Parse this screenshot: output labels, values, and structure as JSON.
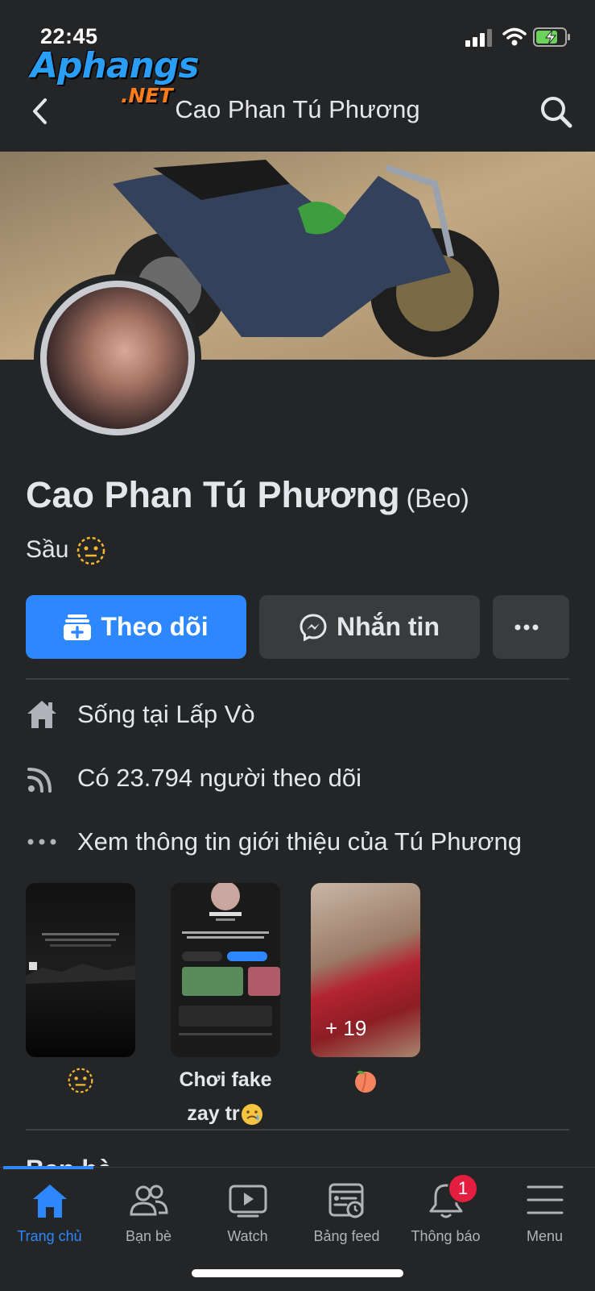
{
  "status_bar": {
    "time": "22:45"
  },
  "watermark": {
    "brand": "Aphangs",
    "domain": ".NET"
  },
  "header": {
    "title": "Cao Phan Tú Phương"
  },
  "profile": {
    "name": "Cao Phan Tú Phương",
    "nickname": "(Beo)",
    "bio": "Sầu"
  },
  "actions": {
    "follow_label": "Theo dõi",
    "message_label": "Nhắn tin"
  },
  "info": {
    "lives_in": "Sống tại Lấp Vò",
    "followers": "Có 23.794 người theo dõi",
    "about": "Xem thông tin giới thiệu của Tú Phương"
  },
  "featured": [
    {
      "caption": ""
    },
    {
      "caption_line1": "Chơi fake",
      "caption_line2": "zay tr"
    },
    {
      "caption": "",
      "count": "+ 19"
    }
  ],
  "sections": {
    "friends_heading": "Bạn bè"
  },
  "tabbar": {
    "tabs": [
      {
        "label": "Trang chủ",
        "icon": "home-icon"
      },
      {
        "label": "Bạn bè",
        "icon": "friends-icon"
      },
      {
        "label": "Watch",
        "icon": "watch-icon"
      },
      {
        "label": "Bảng feed",
        "icon": "feed-icon"
      },
      {
        "label": "Thông báo",
        "icon": "bell-icon"
      },
      {
        "label": "Menu",
        "icon": "menu-icon"
      }
    ],
    "notification_badge": "1"
  },
  "colors": {
    "accent": "#2d88ff",
    "background": "#242526",
    "badge": "#e41e3f"
  }
}
